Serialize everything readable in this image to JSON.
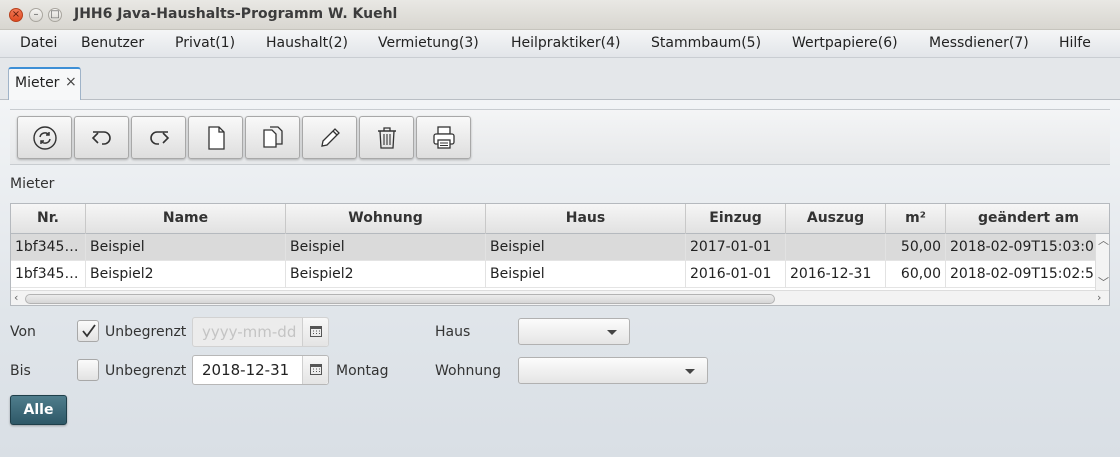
{
  "window": {
    "title": "JHH6 Java-Haushalts-Programm W. Kuehl",
    "close_glyph": "×",
    "min_glyph": "–",
    "max_glyph": "□"
  },
  "menu": [
    {
      "label": "Datei"
    },
    {
      "label": "Benutzer"
    },
    {
      "label": "Privat(1)"
    },
    {
      "label": "Haushalt(2)"
    },
    {
      "label": "Vermietung(3)"
    },
    {
      "label": "Heilpraktiker(4)"
    },
    {
      "label": "Stammbaum(5)"
    },
    {
      "label": "Wertpapiere(6)"
    },
    {
      "label": "Messdiener(7)"
    },
    {
      "label": "Hilfe"
    }
  ],
  "tab": {
    "label": "Mieter",
    "close": "×"
  },
  "toolbar": {
    "buttons": [
      {
        "icon": "refresh-icon"
      },
      {
        "icon": "undo-icon"
      },
      {
        "icon": "redo-icon"
      },
      {
        "icon": "new-document-icon"
      },
      {
        "icon": "copy-icon"
      },
      {
        "icon": "edit-pencil-icon"
      },
      {
        "icon": "delete-trash-icon"
      },
      {
        "icon": "print-icon"
      }
    ]
  },
  "section_label": "Mieter",
  "table": {
    "columns": [
      "Nr.",
      "Name",
      "Wohnung",
      "Haus",
      "Einzug",
      "Auszug",
      "m²",
      "geändert am"
    ],
    "rows": [
      [
        "1bf345…",
        "Beispiel",
        "Beispiel",
        "Beispiel",
        "2017-01-01",
        "",
        "50,00",
        "2018-02-09T15:03:0"
      ],
      [
        "1bf345…",
        "Beispiel2",
        "Beispiel2",
        "Beispiel",
        "2016-01-01",
        "2016-12-31",
        "60,00",
        "2018-02-09T15:02:5"
      ]
    ],
    "selected_row": 0
  },
  "filter": {
    "von_label": "Von",
    "bis_label": "Bis",
    "unbegrenzt_label": "Unbegrenzt",
    "von_unbegrenzt_checked": true,
    "bis_unbegrenzt_checked": false,
    "von_placeholder": "yyyy-mm-dd",
    "bis_value": "2018-12-31",
    "bis_weekday": "Montag",
    "haus_label": "Haus",
    "haus_value": "",
    "wohnung_label": "Wohnung",
    "wohnung_value": "",
    "alle_button": "Alle"
  },
  "colors": {
    "accent_tab": "#3d8fd6",
    "alle_button": "#3c6a79",
    "selected_row": "#dadada"
  }
}
